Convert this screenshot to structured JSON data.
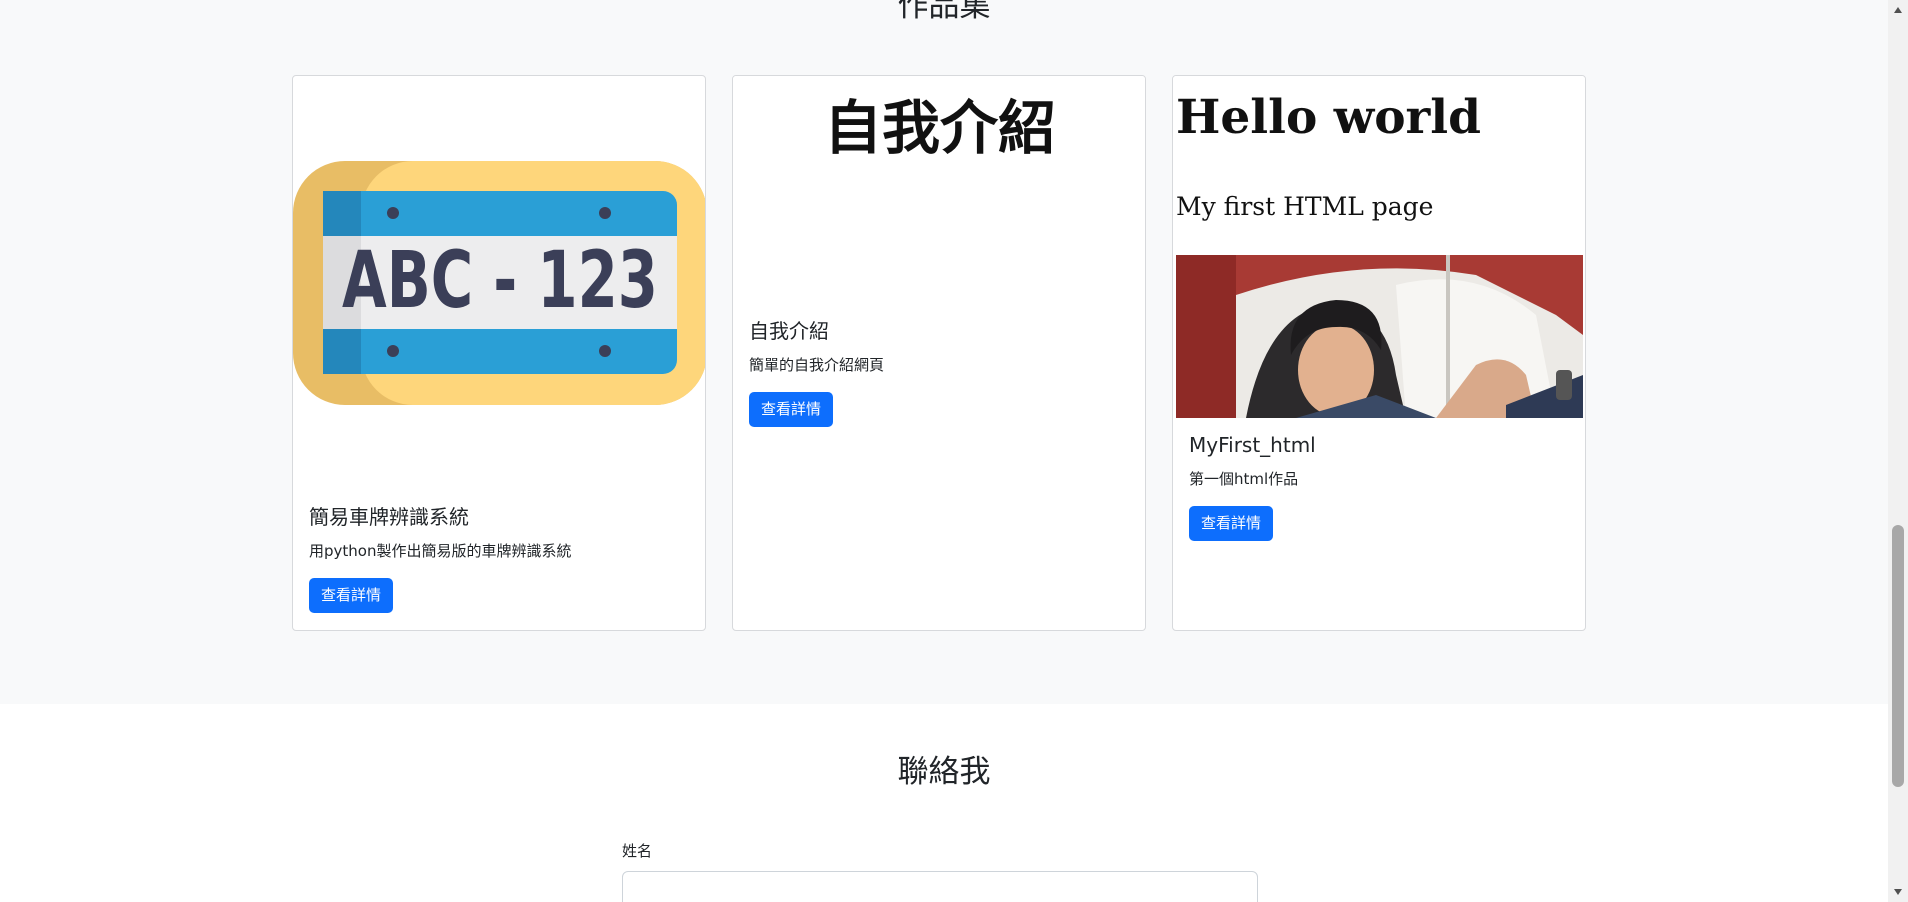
{
  "portfolio": {
    "title": "作品集",
    "cards": [
      {
        "image_text": "ABC - 123",
        "title": "簡易車牌辨識系統",
        "text": "用python製作出簡易版的車牌辨識系統",
        "button": "查看詳情"
      },
      {
        "image_text": "自我介紹",
        "title": "自我介紹",
        "text": "簡單的自我介紹網頁",
        "button": "查看詳情"
      },
      {
        "image_heading": "Hello world",
        "image_subheading": "My first HTML page",
        "title": "MyFirst_html",
        "text": "第一個html作品",
        "button": "查看詳情"
      }
    ]
  },
  "contact": {
    "title": "聯絡我",
    "name_label": "姓名",
    "name_value": ""
  },
  "colors": {
    "primary": "#0d6efd",
    "section_bg": "#f8f9fa",
    "plate_yellow": "#fed67b",
    "plate_blue": "#2a9fd6"
  }
}
